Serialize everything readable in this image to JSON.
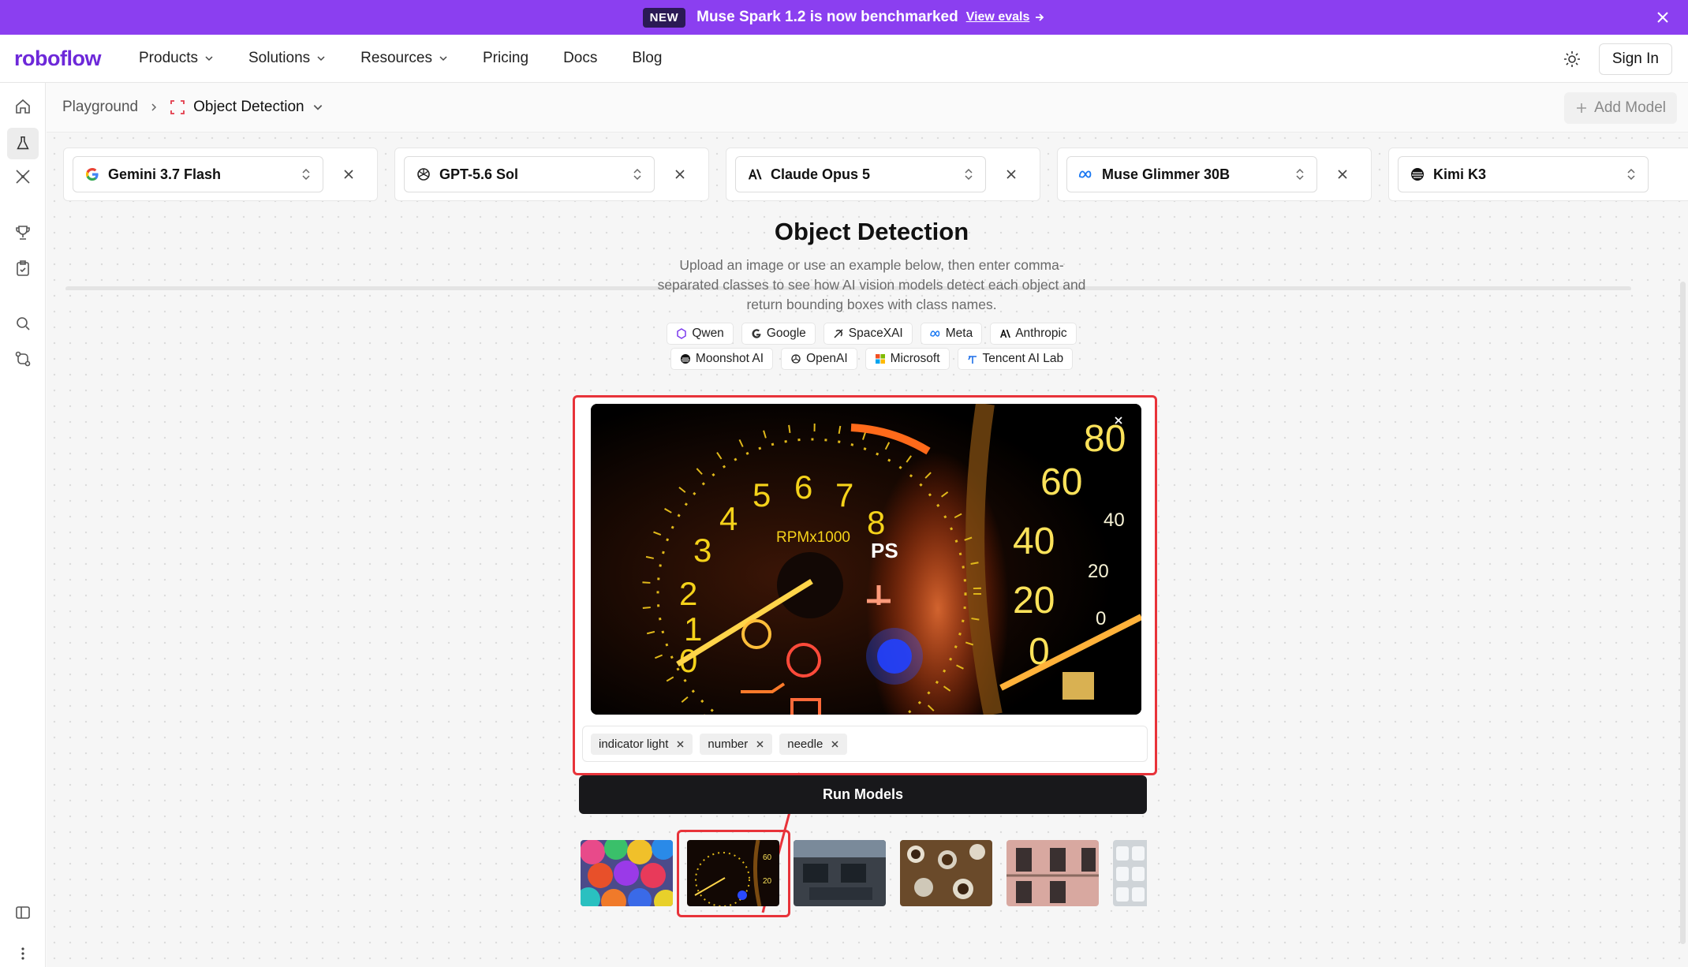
{
  "announcement": {
    "badge": "NEW",
    "message": "Muse Spark 1.2 is now benchmarked",
    "link": "View evals"
  },
  "nav": {
    "logo": "roboflow",
    "items": [
      "Products",
      "Solutions",
      "Resources",
      "Pricing",
      "Docs",
      "Blog"
    ],
    "sign_in": "Sign In"
  },
  "breadcrumb": {
    "root": "Playground",
    "current": "Object Detection"
  },
  "add_model": "Add Model",
  "models": [
    {
      "name": "Gemini 3.7 Flash",
      "logo": "google-icon"
    },
    {
      "name": "GPT-5.6 Sol",
      "logo": "openai-icon"
    },
    {
      "name": "Claude Opus 5",
      "logo": "anthropic-icon"
    },
    {
      "name": "Muse Glimmer 30B",
      "logo": "meta-icon"
    },
    {
      "name": "Kimi K3",
      "logo": "moonshot-icon"
    }
  ],
  "page": {
    "title": "Object Detection",
    "description": "Upload an image or use an example below, then enter comma-separated classes to see how AI vision models detect each object and return bounding boxes with class names."
  },
  "providers_row1": [
    "Qwen",
    "Google",
    "SpaceXAI",
    "Meta",
    "Anthropic"
  ],
  "providers_row2": [
    "Moonshot AI",
    "OpenAI",
    "Microsoft",
    "Tencent AI Lab"
  ],
  "classes": [
    "indicator light",
    "number",
    "needle"
  ],
  "run_button": "Run Models",
  "examples": [
    "umbrellas",
    "dashboard gauges",
    "airplane cockpit",
    "coffee cups",
    "building facade",
    "stadium seats"
  ],
  "colors": {
    "brand": "#6d28d9",
    "announcement_bg": "#8b3ff0",
    "highlight": "#e8333a",
    "run_bg": "#18181b"
  }
}
